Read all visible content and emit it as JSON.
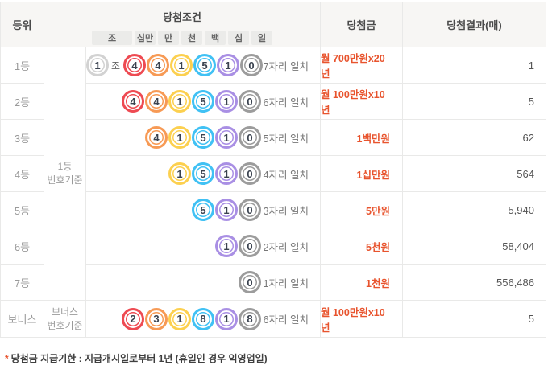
{
  "page": {
    "footnote_marker": "*",
    "footnote": "당첨금 지급기한 : 지급개시일로부터 1년 (휴일인 경우 익영업일)"
  },
  "colors": {
    "prize_text": "#e8542e",
    "ball_digit": "#3a424f",
    "jo_ring": "#d2d2d2",
    "position_rings": [
      "#ee4a52",
      "#f79a55",
      "#fcd04f",
      "#40c1f4",
      "#a98fe4",
      "#9c9c9c"
    ]
  },
  "table": {
    "headers": {
      "rank": "등위",
      "condition": "당첨조건",
      "prize": "당첨금",
      "result": "당첨결과(매)"
    },
    "digit_labels": [
      "조",
      "십만",
      "만",
      "천",
      "백",
      "십",
      "일"
    ],
    "group_cells": {
      "main": [
        "1등",
        "번호기준"
      ],
      "bonus": [
        "보너스",
        "번호기준"
      ]
    },
    "rows": [
      {
        "rank": "1등",
        "jo": {
          "digit": "1",
          "label": "조"
        },
        "digits": [
          "4",
          "4",
          "1",
          "5",
          "1",
          "0"
        ],
        "match": "7자리 일치",
        "prize": "월 700만원x20년",
        "count": "1"
      },
      {
        "rank": "2등",
        "digits": [
          "4",
          "4",
          "1",
          "5",
          "1",
          "0"
        ],
        "match": "6자리 일치",
        "prize": "월 100만원x10년",
        "count": "5"
      },
      {
        "rank": "3등",
        "digits": [
          "4",
          "1",
          "5",
          "1",
          "0"
        ],
        "match": "5자리 일치",
        "prize": "1백만원",
        "count": "62"
      },
      {
        "rank": "4등",
        "digits": [
          "1",
          "5",
          "1",
          "0"
        ],
        "match": "4자리 일치",
        "prize": "1십만원",
        "count": "564"
      },
      {
        "rank": "5등",
        "digits": [
          "5",
          "1",
          "0"
        ],
        "match": "3자리 일치",
        "prize": "5만원",
        "count": "5,940"
      },
      {
        "rank": "6등",
        "digits": [
          "1",
          "0"
        ],
        "match": "2자리 일치",
        "prize": "5천원",
        "count": "58,404"
      },
      {
        "rank": "7등",
        "digits": [
          "0"
        ],
        "match": "1자리 일치",
        "prize": "1천원",
        "count": "556,486"
      },
      {
        "rank": "보너스",
        "digits": [
          "2",
          "3",
          "1",
          "8",
          "1",
          "8"
        ],
        "match": "6자리 일치",
        "prize": "월 100만원x10년",
        "count": "5"
      }
    ]
  }
}
